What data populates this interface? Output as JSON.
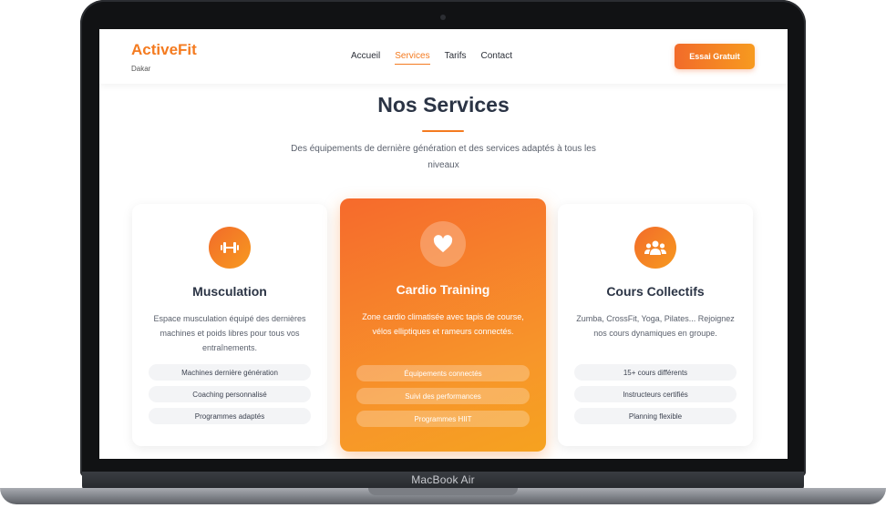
{
  "device": {
    "label": "MacBook Air"
  },
  "header": {
    "brand": "ActiveFit",
    "city": "Dakar",
    "nav": [
      "Accueil",
      "Services",
      "Tarifs",
      "Contact"
    ],
    "active_nav": "Services",
    "cta": "Essai Gratuit"
  },
  "section": {
    "title": "Nos Services",
    "subtitle": "Des équipements de dernière génération et des services adaptés à tous les niveaux"
  },
  "cards": [
    {
      "icon": "dumbbell-icon",
      "title": "Musculation",
      "description": "Espace musculation équipé des dernières machines et poids libres pour tous vos entraînements.",
      "features": [
        "Machines dernière génération",
        "Coaching personnalisé",
        "Programmes adaptés"
      ]
    },
    {
      "icon": "heart-icon",
      "title": "Cardio Training",
      "description": "Zone cardio climatisée avec tapis de course, vélos elliptiques et rameurs connectés.",
      "features": [
        "Équipements connectés",
        "Suivi des performances",
        "Programmes HIIT"
      ]
    },
    {
      "icon": "group-icon",
      "title": "Cours Collectifs",
      "description": "Zumba, CrossFit, Yoga, Pilates... Rejoignez nos cours dynamiques en groupe.",
      "features": [
        "15+ cours différents",
        "Instructeurs certifiés",
        "Planning flexible"
      ]
    }
  ],
  "colors": {
    "accent": "#f47b20",
    "heading": "#2b3445"
  }
}
